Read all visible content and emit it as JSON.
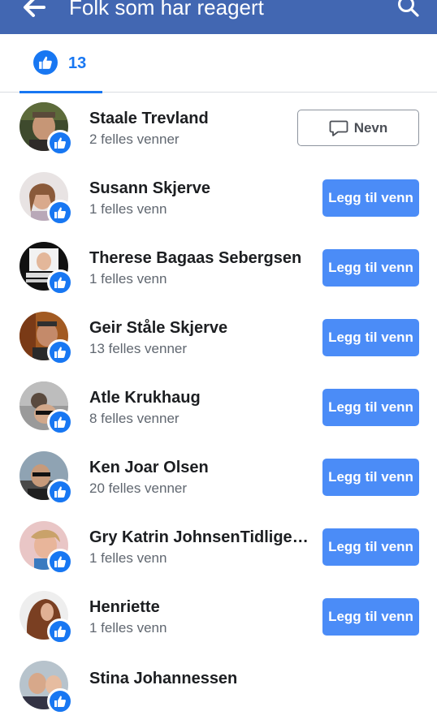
{
  "header": {
    "title": "Folk som har reagert",
    "back_icon": "arrow-left-icon",
    "search_icon": "search-icon",
    "background": "#4267b2"
  },
  "tabs": {
    "like_count": "13",
    "like_icon": "thumbs-up-icon",
    "accent": "#1877f2"
  },
  "people": [
    {
      "name": "Staale Trevland",
      "mutual": "2 felles venner",
      "action": "Nevn"
    },
    {
      "name": "Susann Skjerve",
      "mutual": "1 felles venn",
      "action": "Legg til venn"
    },
    {
      "name": "Therese Bagaas Sebergsen",
      "mutual": "1 felles venn",
      "action": "Legg til venn"
    },
    {
      "name": "Geir Ståle Skjerve",
      "mutual": "13 felles venner",
      "action": "Legg til venn"
    },
    {
      "name": "Atle Krukhaug",
      "mutual": "8 felles venner",
      "action": "Legg til venn"
    },
    {
      "name": "Ken Joar Olsen",
      "mutual": "20 felles venner",
      "action": "Legg til venn"
    },
    {
      "name": "Gry Katrin JohnsenTidligere Bakke",
      "mutual": "1 felles venn",
      "action": "Legg til venn"
    },
    {
      "name": "Henriette",
      "mutual": "1 felles venn",
      "action": "Legg til venn"
    },
    {
      "name": "Stina Johannessen"
    }
  ]
}
